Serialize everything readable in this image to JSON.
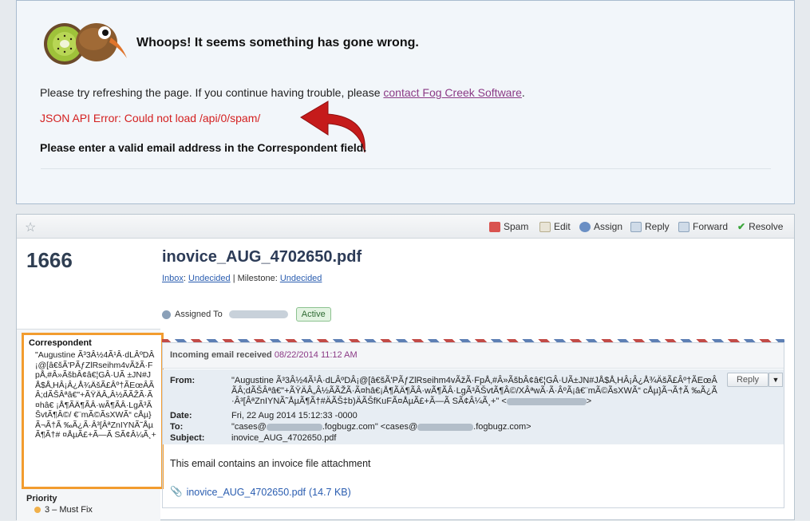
{
  "error": {
    "title": "Whoops! It seems something has gone wrong.",
    "refresh_text": "Please try refreshing the page. If you continue having trouble, please ",
    "contact_link": "contact Fog Creek Software",
    "refresh_tail": ".",
    "json_error": "JSON API Error: Could not load /api/0/spam/",
    "validation": "Please enter a valid email address in the Correspondent field."
  },
  "toolbar": {
    "spam": "Spam",
    "edit": "Edit",
    "assign": "Assign",
    "reply": "Reply",
    "forward": "Forward",
    "resolve": "Resolve"
  },
  "case": {
    "number": "1666",
    "title": "inovice_AUG_4702650.pdf",
    "project": "Inbox",
    "area": "Undecided",
    "milestone_label": "Milestone:",
    "milestone": "Undecided",
    "assigned_label": "Assigned To",
    "status": "Active"
  },
  "sidebar": {
    "correspondent_label": "Correspondent",
    "correspondent_value": "\"Augustine Ã³3Â½4Ã¹Â·dLÂºDÂ¡@[â€šÃ'PÃƒZlRseihm4vÃžÃ·FpÅ‚#Â»ÃšbÂ¢â€¦GÂ·UÃ ±JN#JÅ$Å‚HÂ¡Â¿Å¾ÄšÃ£Âº†ÃEœÂÃÂ;dÃŠÂªâ€\"+ÃŸÄÂ„Â½ÃÃŽÃ·Ã¤hâ€ ¡Å¶ÃÄ¶ÃÂ·wÃ¶ÃÂ·LgÃ³ÃŠvtÃ¶Â©/ €¨mÃ©ÃsXWÃ“ cÅµ} Ã¬Ã†Ã ‰Ã¿Ã·Â³[ÂªZnIYNÃ˜ÅµÃ¶Ã†# ¤ÅµÃ£+Ã—Ã SÃ¢Â¼Ã¸+",
    "priority_label": "Priority",
    "priority_value": "3 – Must Fix"
  },
  "mail": {
    "header": "Incoming email received",
    "date_stamp": "08/22/2014 11:12 AM",
    "from_label": "From:",
    "from_value": "\"Augustine Ã³3Â½4Ã¹Â·dLÂºDÂ¡@[â€šÃ'PÃƒZlRseihm4vÃžÃ·FpÅ‚#Â»ÃšbÂ¢â€¦GÂ·UÃ±JN#JÅ$Å‚HÂ¡Â¿Å¾ÄšÃ£Âº†ÃEœÂÃÂ;dÃŠÂªâ€\"+ÃŸÄÂ„Â½ÃÃŽÃ·Ã¤hâ€¡Å¶ÃÄ¶ÃÂ·wÃ¶ÃÂ·LgÃ³ÃŠvtÃ¶Â©/XÂªwÃ·Ã·ÂºÃ¡â€¨mÃ©ÃsXWÃ“ cÅµ}Ã¬Ã†Ã ‰Ã¿Ã·Â³[ÂªZnIYNÃ˜ÅµÃ¶Ã†#ÄÃŠ‡b)ÄÃŠfKuFÃ¤ÅµÃ£+Ã—Ã SÃ¢Â¼Ã¸+\" <",
    "from_tail": ">",
    "date_label": "Date:",
    "date_value": "Fri, 22 Aug 2014 15:12:33 -0000",
    "to_label": "To:",
    "to_value_1": "\"cases@",
    "to_value_2": ".fogbugz.com\" <cases@",
    "to_value_3": ".fogbugz.com>",
    "subject_label": "Subject:",
    "subject_value": "inovice_AUG_4702650.pdf",
    "reply_button": "Reply",
    "body": "This email contains an invoice file attachment",
    "attachment_name": "inovice_AUG_4702650.pdf",
    "attachment_size": "(14.7 KB)"
  },
  "colors": {
    "error_red": "#d42020",
    "link_purple": "#8b3a86",
    "highlight_orange": "#f29c2f",
    "title_navy": "#2c3b57"
  }
}
